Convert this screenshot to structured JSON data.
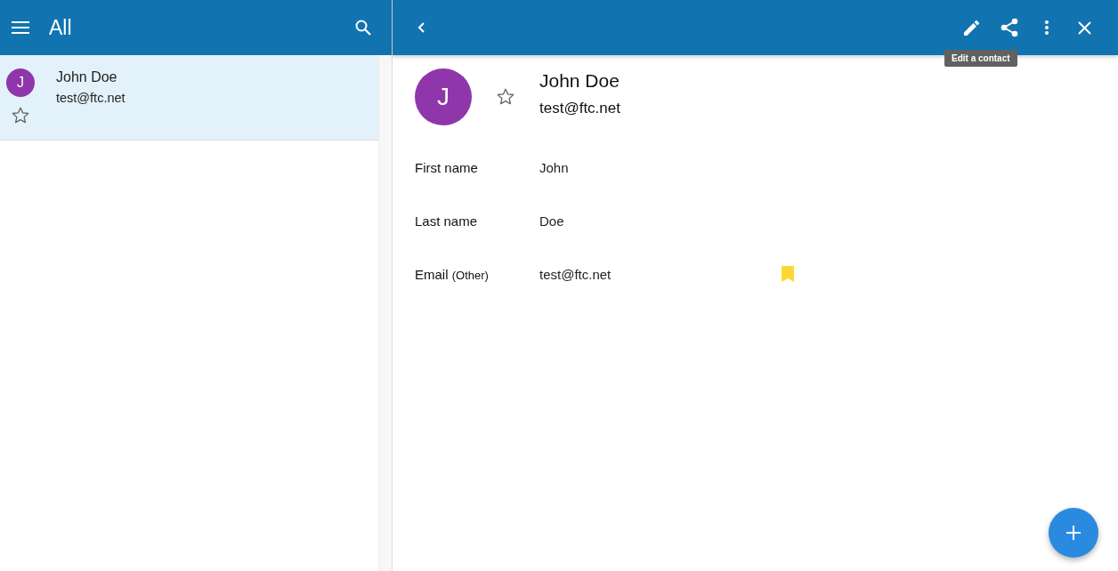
{
  "list_header": {
    "title": "All"
  },
  "contacts": [
    {
      "initial": "J",
      "name": "John Doe",
      "email": "test@ftc.net",
      "selected": true,
      "starred": false
    }
  ],
  "detail": {
    "initial": "J",
    "name": "John Doe",
    "email": "test@ftc.net",
    "starred": false,
    "tooltip": "Edit a contact",
    "fields": [
      {
        "label": "First name",
        "value": "John",
        "primary": false
      },
      {
        "label": "Last name",
        "value": "Doe",
        "primary": false
      },
      {
        "label": "Email",
        "sublabel": "(Other)",
        "value": "test@ftc.net",
        "primary": true
      }
    ]
  }
}
